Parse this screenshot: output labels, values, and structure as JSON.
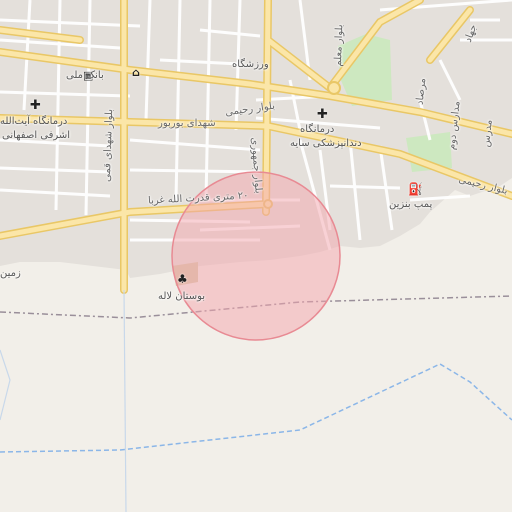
{
  "colors": {
    "background": "#f2efe9",
    "residential": "#e4e0db",
    "block_border": "#ffffff",
    "major_road": "#fbe6a8",
    "major_road_edge": "#e9c766",
    "minor_road": "#ffffff",
    "park": "#cde8c0",
    "highlight_fill": "#f4a6ae",
    "highlight_stroke": "#e88a93",
    "boundary": "#9a8f9a",
    "waterway": "#8bb6e8"
  },
  "labels": {
    "bank_meli": "بانک ملی",
    "varzeshgah": "ورزشگاه",
    "darmangah_ayatollah": "درمانگاه آیت‌الله",
    "ashrafi_esfahani": "اشرفی اصفهانی",
    "boulevard_rahimi_1": "بلوار رحیمی",
    "boulevard_rahimi_2": "بلوار رحیمی",
    "shohada_boorboor": "شهدای بوربور",
    "boulevard_shohada_ghomi": "بلوار شهدای قمی",
    "darmangah": "درمانگاه",
    "dandanpezeshki_saye": "دندانپزشکی سایه",
    "boulevard_jomhouri": "بلوار جمهوری",
    "boulevard_moallem": "بلوار معلم",
    "mersad": "مرصاد",
    "madares_doom": "مدارس دوم",
    "madares": "مدرس",
    "pomp_benzin": "پمپ بنزین",
    "metri_20": "۲۰ متری قدرت الله غربا",
    "bostan_laleh": "بوستان لاله",
    "zamin": "زمین",
    "jahad": "جهاد"
  },
  "icons": {
    "bank": "bank-icon",
    "shop": "shop-icon",
    "hospital": "hospital-icon",
    "fuel": "fuel-station-icon",
    "park": "park-icon",
    "circle": "roundabout-icon"
  }
}
